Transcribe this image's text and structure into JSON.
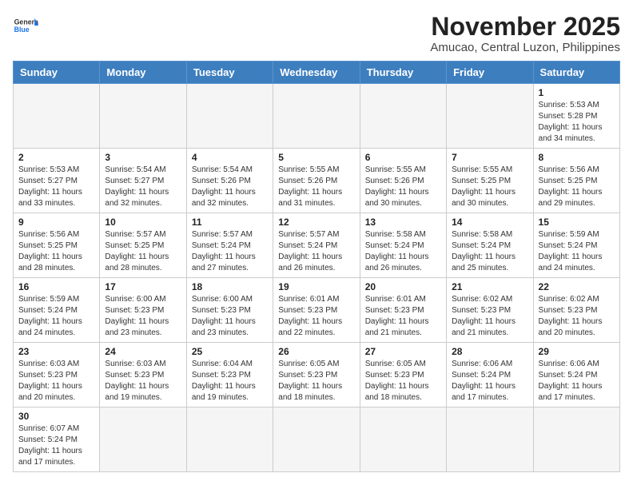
{
  "header": {
    "logo_general": "General",
    "logo_blue": "Blue",
    "month_title": "November 2025",
    "location": "Amucao, Central Luzon, Philippines"
  },
  "weekdays": [
    "Sunday",
    "Monday",
    "Tuesday",
    "Wednesday",
    "Thursday",
    "Friday",
    "Saturday"
  ],
  "weeks": [
    [
      {
        "day": "",
        "empty": true
      },
      {
        "day": "",
        "empty": true
      },
      {
        "day": "",
        "empty": true
      },
      {
        "day": "",
        "empty": true
      },
      {
        "day": "",
        "empty": true
      },
      {
        "day": "",
        "empty": true
      },
      {
        "day": "1",
        "sunrise": "5:53 AM",
        "sunset": "5:28 PM",
        "daylight": "11 hours and 34 minutes."
      }
    ],
    [
      {
        "day": "2",
        "sunrise": "5:53 AM",
        "sunset": "5:27 PM",
        "daylight": "11 hours and 33 minutes."
      },
      {
        "day": "3",
        "sunrise": "5:54 AM",
        "sunset": "5:27 PM",
        "daylight": "11 hours and 32 minutes."
      },
      {
        "day": "4",
        "sunrise": "5:54 AM",
        "sunset": "5:26 PM",
        "daylight": "11 hours and 32 minutes."
      },
      {
        "day": "5",
        "sunrise": "5:55 AM",
        "sunset": "5:26 PM",
        "daylight": "11 hours and 31 minutes."
      },
      {
        "day": "6",
        "sunrise": "5:55 AM",
        "sunset": "5:26 PM",
        "daylight": "11 hours and 30 minutes."
      },
      {
        "day": "7",
        "sunrise": "5:55 AM",
        "sunset": "5:25 PM",
        "daylight": "11 hours and 30 minutes."
      },
      {
        "day": "8",
        "sunrise": "5:56 AM",
        "sunset": "5:25 PM",
        "daylight": "11 hours and 29 minutes."
      }
    ],
    [
      {
        "day": "9",
        "sunrise": "5:56 AM",
        "sunset": "5:25 PM",
        "daylight": "11 hours and 28 minutes."
      },
      {
        "day": "10",
        "sunrise": "5:57 AM",
        "sunset": "5:25 PM",
        "daylight": "11 hours and 28 minutes."
      },
      {
        "day": "11",
        "sunrise": "5:57 AM",
        "sunset": "5:24 PM",
        "daylight": "11 hours and 27 minutes."
      },
      {
        "day": "12",
        "sunrise": "5:57 AM",
        "sunset": "5:24 PM",
        "daylight": "11 hours and 26 minutes."
      },
      {
        "day": "13",
        "sunrise": "5:58 AM",
        "sunset": "5:24 PM",
        "daylight": "11 hours and 26 minutes."
      },
      {
        "day": "14",
        "sunrise": "5:58 AM",
        "sunset": "5:24 PM",
        "daylight": "11 hours and 25 minutes."
      },
      {
        "day": "15",
        "sunrise": "5:59 AM",
        "sunset": "5:24 PM",
        "daylight": "11 hours and 24 minutes."
      }
    ],
    [
      {
        "day": "16",
        "sunrise": "5:59 AM",
        "sunset": "5:24 PM",
        "daylight": "11 hours and 24 minutes."
      },
      {
        "day": "17",
        "sunrise": "6:00 AM",
        "sunset": "5:23 PM",
        "daylight": "11 hours and 23 minutes."
      },
      {
        "day": "18",
        "sunrise": "6:00 AM",
        "sunset": "5:23 PM",
        "daylight": "11 hours and 23 minutes."
      },
      {
        "day": "19",
        "sunrise": "6:01 AM",
        "sunset": "5:23 PM",
        "daylight": "11 hours and 22 minutes."
      },
      {
        "day": "20",
        "sunrise": "6:01 AM",
        "sunset": "5:23 PM",
        "daylight": "11 hours and 21 minutes."
      },
      {
        "day": "21",
        "sunrise": "6:02 AM",
        "sunset": "5:23 PM",
        "daylight": "11 hours and 21 minutes."
      },
      {
        "day": "22",
        "sunrise": "6:02 AM",
        "sunset": "5:23 PM",
        "daylight": "11 hours and 20 minutes."
      }
    ],
    [
      {
        "day": "23",
        "sunrise": "6:03 AM",
        "sunset": "5:23 PM",
        "daylight": "11 hours and 20 minutes."
      },
      {
        "day": "24",
        "sunrise": "6:03 AM",
        "sunset": "5:23 PM",
        "daylight": "11 hours and 19 minutes."
      },
      {
        "day": "25",
        "sunrise": "6:04 AM",
        "sunset": "5:23 PM",
        "daylight": "11 hours and 19 minutes."
      },
      {
        "day": "26",
        "sunrise": "6:05 AM",
        "sunset": "5:23 PM",
        "daylight": "11 hours and 18 minutes."
      },
      {
        "day": "27",
        "sunrise": "6:05 AM",
        "sunset": "5:23 PM",
        "daylight": "11 hours and 18 minutes."
      },
      {
        "day": "28",
        "sunrise": "6:06 AM",
        "sunset": "5:24 PM",
        "daylight": "11 hours and 17 minutes."
      },
      {
        "day": "29",
        "sunrise": "6:06 AM",
        "sunset": "5:24 PM",
        "daylight": "11 hours and 17 minutes."
      }
    ],
    [
      {
        "day": "30",
        "sunrise": "6:07 AM",
        "sunset": "5:24 PM",
        "daylight": "11 hours and 17 minutes.",
        "last": true
      },
      {
        "day": "",
        "empty": true,
        "last": true
      },
      {
        "day": "",
        "empty": true,
        "last": true
      },
      {
        "day": "",
        "empty": true,
        "last": true
      },
      {
        "day": "",
        "empty": true,
        "last": true
      },
      {
        "day": "",
        "empty": true,
        "last": true
      },
      {
        "day": "",
        "empty": true,
        "last": true
      }
    ]
  ],
  "labels": {
    "sunrise_label": "Sunrise:",
    "sunset_label": "Sunset:",
    "daylight_label": "Daylight:"
  }
}
